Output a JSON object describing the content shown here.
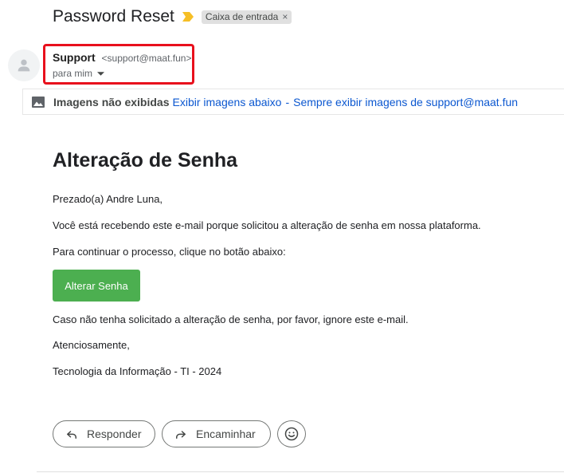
{
  "header": {
    "subject": "Password Reset",
    "label": "Caixa de entrada",
    "label_remove": "×"
  },
  "sender": {
    "name": "Support",
    "email": "<support@maat.fun>",
    "recipient": "para mim"
  },
  "images_bar": {
    "title": "Imagens não exibidas",
    "show_below": "Exibir imagens abaixo",
    "separator": "-",
    "always_show": "Sempre exibir imagens de support@maat.fun"
  },
  "body": {
    "heading": "Alteração de Senha",
    "greeting": "Prezado(a) Andre Luna,",
    "line1": "Você está recebendo este e-mail porque solicitou a alteração de senha em nossa plataforma.",
    "line2": "Para continuar o processo, clique no botão abaixo:",
    "button": "Alterar Senha",
    "line3": "Caso não tenha solicitado a alteração de senha, por favor, ignore este e-mail.",
    "closing": "Atenciosamente,",
    "signature": "Tecnologia da Informação - TI - 2024"
  },
  "actions": {
    "reply": "Responder",
    "forward": "Encaminhar"
  },
  "icons": {
    "importance": "importance-marker-icon",
    "avatar": "person-icon",
    "dropdown": "caret-down-icon",
    "image": "image-icon",
    "reply": "reply-arrow-icon",
    "forward": "forward-arrow-icon",
    "emoji": "smiley-icon"
  },
  "colors": {
    "highlight_border": "#e8101c",
    "link": "#0b57d0",
    "cta_background": "#4caf50",
    "importance_marker": "#f6bf26"
  }
}
